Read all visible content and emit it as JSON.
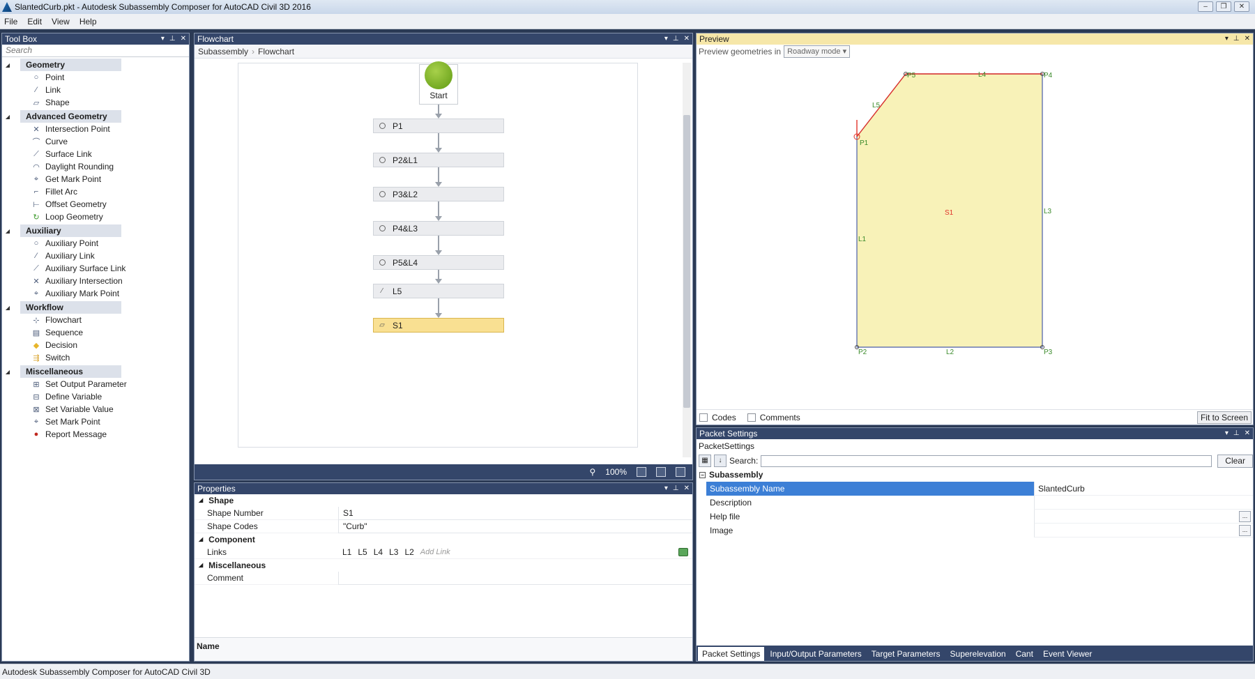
{
  "window": {
    "title": "SlantedCurb.pkt - Autodesk Subassembly Composer for AutoCAD Civil 3D 2016"
  },
  "menu": [
    "File",
    "Edit",
    "View",
    "Help"
  ],
  "toolbox": {
    "title": "Tool Box",
    "search_placeholder": "Search",
    "categories": [
      {
        "label": "Geometry",
        "items": [
          {
            "label": "Point",
            "icon": "point-icon"
          },
          {
            "label": "Link",
            "icon": "link-icon"
          },
          {
            "label": "Shape",
            "icon": "shape-icon"
          }
        ]
      },
      {
        "label": "Advanced Geometry",
        "items": [
          {
            "label": "Intersection Point",
            "icon": "intersection-point-icon"
          },
          {
            "label": "Curve",
            "icon": "curve-icon"
          },
          {
            "label": "Surface Link",
            "icon": "surface-link-icon"
          },
          {
            "label": "Daylight Rounding",
            "icon": "daylight-rounding-icon"
          },
          {
            "label": "Get Mark Point",
            "icon": "get-mark-point-icon"
          },
          {
            "label": "Fillet Arc",
            "icon": "fillet-arc-icon"
          },
          {
            "label": "Offset Geometry",
            "icon": "offset-geometry-icon"
          },
          {
            "label": "Loop Geometry",
            "icon": "loop-geometry-icon"
          }
        ]
      },
      {
        "label": "Auxiliary",
        "items": [
          {
            "label": "Auxiliary Point",
            "icon": "auxiliary-point-icon"
          },
          {
            "label": "Auxiliary Link",
            "icon": "auxiliary-link-icon"
          },
          {
            "label": "Auxiliary Surface Link",
            "icon": "auxiliary-surface-link-icon"
          },
          {
            "label": "Auxiliary Intersection",
            "icon": "auxiliary-intersection-icon"
          },
          {
            "label": "Auxiliary Mark Point",
            "icon": "auxiliary-mark-point-icon"
          }
        ]
      },
      {
        "label": "Workflow",
        "items": [
          {
            "label": "Flowchart",
            "icon": "flowchart-icon"
          },
          {
            "label": "Sequence",
            "icon": "sequence-icon"
          },
          {
            "label": "Decision",
            "icon": "decision-icon"
          },
          {
            "label": "Switch",
            "icon": "switch-icon"
          }
        ]
      },
      {
        "label": "Miscellaneous",
        "items": [
          {
            "label": "Set Output Parameter",
            "icon": "set-output-parameter-icon"
          },
          {
            "label": "Define Variable",
            "icon": "define-variable-icon"
          },
          {
            "label": "Set Variable Value",
            "icon": "set-variable-value-icon"
          },
          {
            "label": "Set Mark Point",
            "icon": "set-mark-point-icon"
          },
          {
            "label": "Report Message",
            "icon": "report-message-icon"
          }
        ]
      }
    ]
  },
  "flowchart": {
    "title": "Flowchart",
    "breadcrumb": [
      "Subassembly",
      "Flowchart"
    ],
    "start_label": "Start",
    "nodes": [
      {
        "label": "P1",
        "icon": "point-icon",
        "selected": false
      },
      {
        "label": "P2&L1",
        "icon": "point-icon",
        "selected": false
      },
      {
        "label": "P3&L2",
        "icon": "point-icon",
        "selected": false
      },
      {
        "label": "P4&L3",
        "icon": "point-icon",
        "selected": false
      },
      {
        "label": "P5&L4",
        "icon": "point-icon",
        "selected": false
      },
      {
        "label": "L5",
        "icon": "link-icon",
        "selected": false
      },
      {
        "label": "S1",
        "icon": "shape-icon",
        "selected": true
      }
    ],
    "zoom": "100%"
  },
  "properties": {
    "title": "Properties",
    "sections": {
      "shape": "Shape",
      "component": "Component",
      "misc": "Miscellaneous"
    },
    "shape_number_label": "Shape Number",
    "shape_number_value": "S1",
    "shape_codes_label": "Shape Codes",
    "shape_codes_value": "\"Curb\"",
    "links_label": "Links",
    "links": [
      "L1",
      "L5",
      "L4",
      "L3",
      "L2"
    ],
    "add_link": "Add Link",
    "comment_label": "Comment",
    "comment_value": "",
    "footer_name": "Name"
  },
  "preview": {
    "title": "Preview",
    "geometries_label": "Preview geometries in",
    "mode": "Roadway mode",
    "points": [
      "P1",
      "P2",
      "P3",
      "P4",
      "P5"
    ],
    "links": [
      "L1",
      "L2",
      "L3",
      "L4",
      "L5"
    ],
    "shape": "S1",
    "codes_label": "Codes",
    "comments_label": "Comments",
    "fit_label": "Fit to Screen",
    "colors": {
      "shape_fill": "#f8f2b8",
      "link": "#4a5ea8",
      "selected_link": "#e0322a",
      "label": "#3a8a2a"
    }
  },
  "packet": {
    "title": "Packet Settings",
    "subtitle": "PacketSettings",
    "search_label": "Search:",
    "search_value": "",
    "clear_label": "Clear",
    "section": "Subassembly",
    "rows": [
      {
        "name": "Subassembly Name",
        "value": "SlantedCurb",
        "selected": true,
        "ellipsis": false
      },
      {
        "name": "Description",
        "value": "",
        "selected": false,
        "ellipsis": false
      },
      {
        "name": "Help file",
        "value": "",
        "selected": false,
        "ellipsis": true
      },
      {
        "name": "Image",
        "value": "",
        "selected": false,
        "ellipsis": true
      }
    ],
    "tabs": [
      "Packet Settings",
      "Input/Output Parameters",
      "Target Parameters",
      "Superelevation",
      "Cant",
      "Event Viewer"
    ],
    "active_tab": "Packet Settings"
  },
  "status": "Autodesk Subassembly Composer for AutoCAD Civil 3D"
}
